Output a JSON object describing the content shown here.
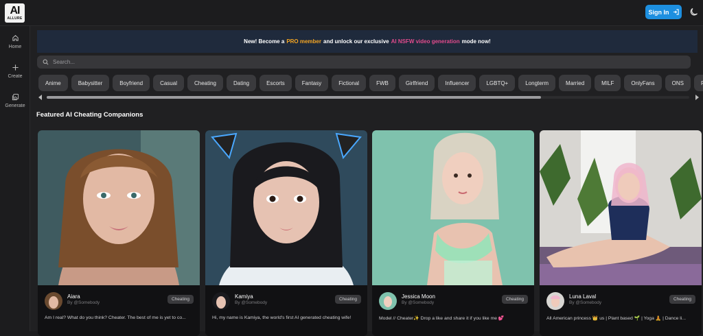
{
  "app": {
    "logo_big": "AI",
    "logo_small": "ALLURE"
  },
  "header": {
    "sign_in_label": "Sign In",
    "theme_icon": "moon-icon"
  },
  "sidebar": {
    "items": [
      {
        "label": "Home",
        "icon": "home-icon"
      },
      {
        "label": "Create",
        "icon": "plus-icon"
      },
      {
        "label": "Generate",
        "icon": "images-icon"
      }
    ]
  },
  "banner": {
    "prefix": "New! Become a",
    "pro": "PRO member",
    "middle": "and unlock our exclusive",
    "video": "AI NSFW video generation",
    "suffix": "mode now!",
    "pro_color": "#f5a623",
    "video_color": "#e14b8c"
  },
  "search": {
    "placeholder": "Search..."
  },
  "tags": [
    "Anime",
    "Babysitter",
    "Boyfriend",
    "Casual",
    "Cheating",
    "Dating",
    "Escorts",
    "Fantasy",
    "Fictional",
    "FWB",
    "Girlfriend",
    "Influencer",
    "LGBTQ+",
    "Longterm",
    "Married",
    "MILF",
    "OnlyFans",
    "ONS",
    "Porns"
  ],
  "section": {
    "title": "Featured AI Cheating Companions"
  },
  "cards": [
    {
      "name": "Aiara",
      "by": "By @Somebody",
      "badge": "Cheating",
      "desc": "Am I real? What do you think? Cheater. The best of me is yet to co..."
    },
    {
      "name": "Kamiya",
      "by": "By @Somebody",
      "badge": "Cheating",
      "desc": "Hi, my name is Kamiya, the world's first AI generated cheating wife!"
    },
    {
      "name": "Jessica Moon",
      "by": "By @Somebody",
      "badge": "Cheating",
      "desc": "Model // Cheater✨ Drop a like and share it if you like me 💕"
    },
    {
      "name": "Luna Laval",
      "by": "By @Somebody",
      "badge": "Cheating",
      "desc": "All American princess 👑 us | Plant based 🌱 | Yoga 🧘 | Dance li..."
    }
  ],
  "colors": {
    "accent": "#1d8fe0",
    "background": "#1c1c1e"
  }
}
